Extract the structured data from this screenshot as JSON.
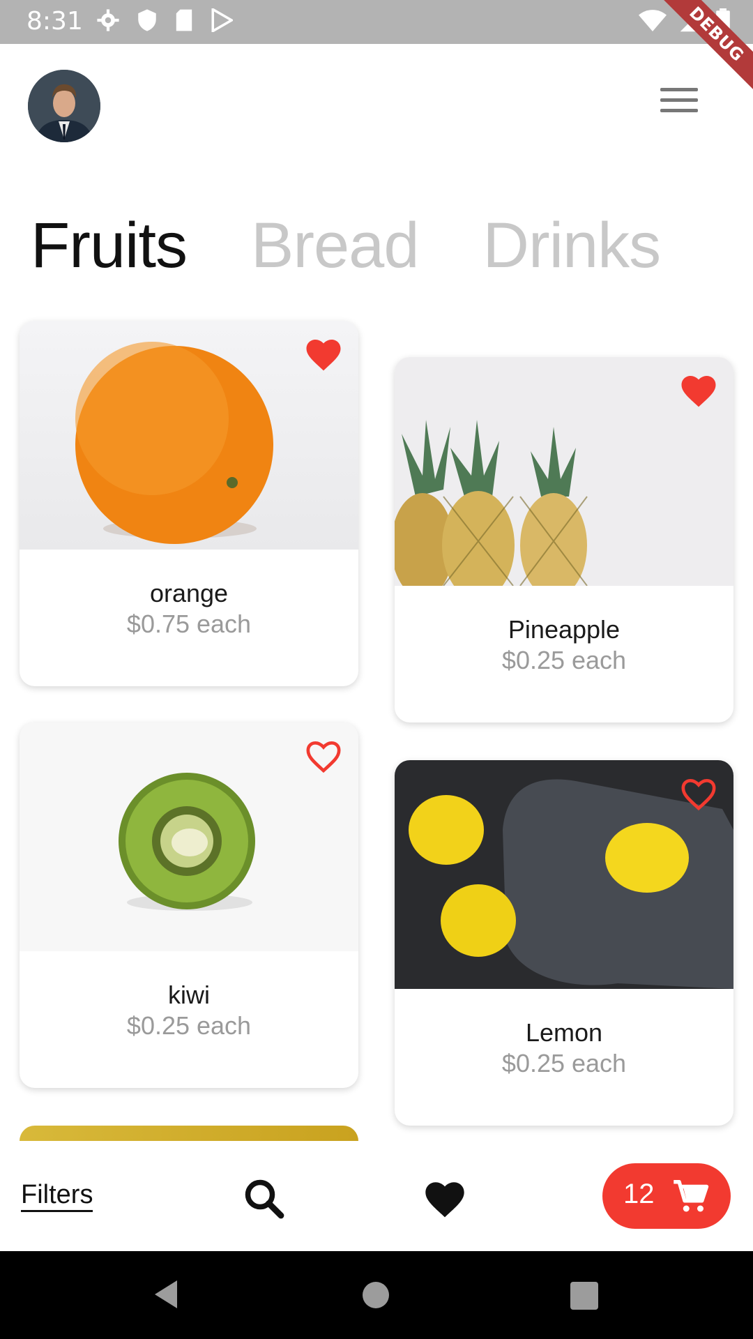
{
  "status_bar": {
    "time": "8:31",
    "debug_label": "DEBUG"
  },
  "header": {
    "avatar_icon": "user-avatar",
    "menu_icon": "hamburger-menu-icon"
  },
  "tabs": [
    {
      "label": "Fruits",
      "active": true
    },
    {
      "label": "Bread",
      "active": false
    },
    {
      "label": "Drinks",
      "active": false
    }
  ],
  "products": [
    {
      "name": "orange",
      "price": "$0.75 each",
      "favorite": true
    },
    {
      "name": "Pineapple",
      "price": "$0.25 each",
      "favorite": true
    },
    {
      "name": "kiwi",
      "price": "$0.25 each",
      "favorite": false
    },
    {
      "name": "Lemon",
      "price": "$0.25 each",
      "favorite": false
    }
  ],
  "bottom_bar": {
    "filters_label": "Filters",
    "cart_count": "12"
  },
  "colors": {
    "accent": "#f23a30",
    "active_tab": "#111111",
    "inactive_tab": "#c8c8c8",
    "price": "#9a9a9a"
  }
}
